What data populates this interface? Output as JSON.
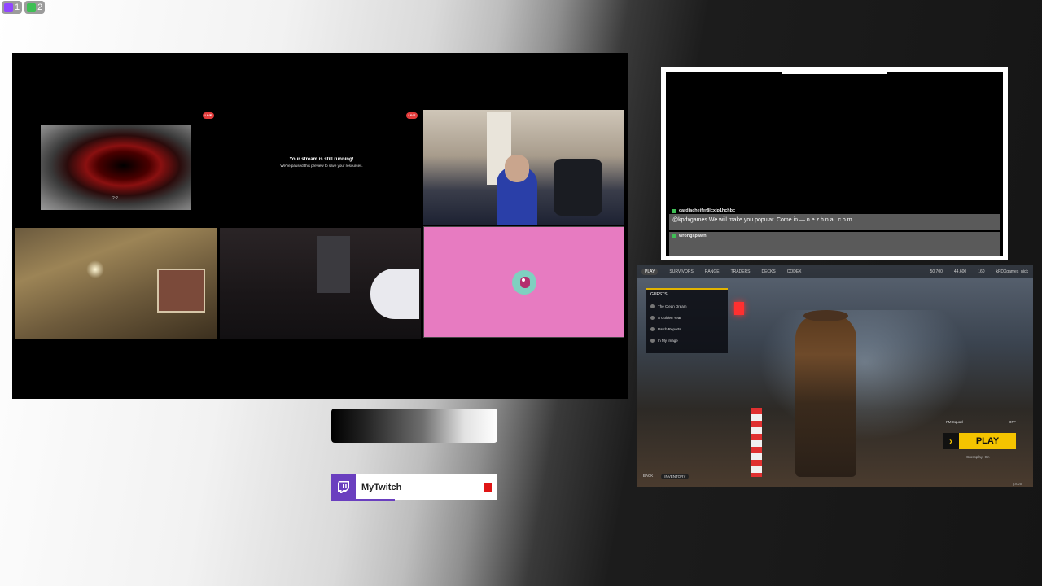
{
  "counters": [
    {
      "value": "1",
      "icon": "twitch-icon",
      "color": "#9146ff"
    },
    {
      "value": "2",
      "icon": "green-status-icon",
      "color": "#3fbf55"
    }
  ],
  "video_grid": {
    "live_badge": "LIVE",
    "paused_title": "Your stream is still running!",
    "paused_subtitle": "We've paused this preview to save your resources.",
    "counter_text": "2:2"
  },
  "chat": {
    "messages": [
      {
        "user": "cardiacheifer8lcxlp1hchbc",
        "text": "@kpdxgames We will make you popular. Come in — n e z h n a . c o m"
      },
      {
        "user": "wrongspawn",
        "text": ""
      }
    ]
  },
  "game": {
    "nav": [
      "PLAY",
      "SURVIVORS",
      "RANGE",
      "TRADERS",
      "DECKS",
      "CODEX"
    ],
    "currency": [
      "50,700",
      "44,600",
      "160"
    ],
    "player_tag": "kPDXgames_nick",
    "menu_head": "GUESTS",
    "menu_items": [
      "The Clean Dream",
      "A Golden Year",
      "Patch Reports",
      "In My Image"
    ],
    "play_label": "PLAY",
    "mode_label": "FM Squad",
    "mode_value": "OFF",
    "crossplay": "Crossplay: On",
    "bottom_tabs": [
      "BACK",
      "INVENTORY"
    ],
    "version": "p3028"
  },
  "twitch_card": {
    "name": "MyTwitch",
    "accent": "#6a3fbf"
  }
}
